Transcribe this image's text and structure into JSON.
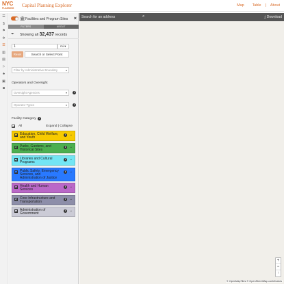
{
  "header": {
    "logo_nyc": "NYC",
    "logo_planning": "PLANNING",
    "title": "Capital Planning Explorer",
    "nav": {
      "map": "Map",
      "table": "Table",
      "about": "About"
    }
  },
  "panel": {
    "title": "Facilities and Program Sites",
    "tabs": {
      "filters": "FILTERS",
      "about": "ABOUT"
    },
    "records": {
      "prefix": "Showing all",
      "count": "32,437",
      "suffix": "records"
    },
    "radius": {
      "value": "1",
      "unit": "mi"
    },
    "reset_label": "Reset",
    "select_point_label": "Search or Select Point",
    "admin_boundary_placeholder": "Filter by Administrative Boundary",
    "operators_heading": "Operators and Oversight",
    "oversight_placeholder": "Oversight Agencies",
    "operator_types_placeholder": "Operator Types",
    "facility_category_heading": "Facility Category",
    "all_label": "All",
    "expand_collapse": "Expand | Collapse",
    "categories": [
      {
        "label": "Education, Child Welfare, and Youth",
        "color": "#f7ca00"
      },
      {
        "label": "Parks, Gardens, and Historical Sites",
        "color": "#4caf50"
      },
      {
        "label": "Libraries and Cultural Programs",
        "color": "#73e5f4"
      },
      {
        "label": "Public Safety, Emergency Services, and Administration of Justice",
        "color": "#2979ff"
      },
      {
        "label": "Health and Human Services",
        "color": "#ba68c8"
      },
      {
        "label": "Core Infrastructure and Transportation",
        "color": "#8d8ea9"
      },
      {
        "label": "Administration of Government",
        "color": "#cbcbd6"
      }
    ]
  },
  "map": {
    "search_placeholder": "Search for an address",
    "download_label": "Download",
    "zoom_in": "+",
    "zoom_out": "−",
    "reset_north": "↑",
    "attribution": "© OpenMapTiles © OpenStreetMap contributors"
  }
}
